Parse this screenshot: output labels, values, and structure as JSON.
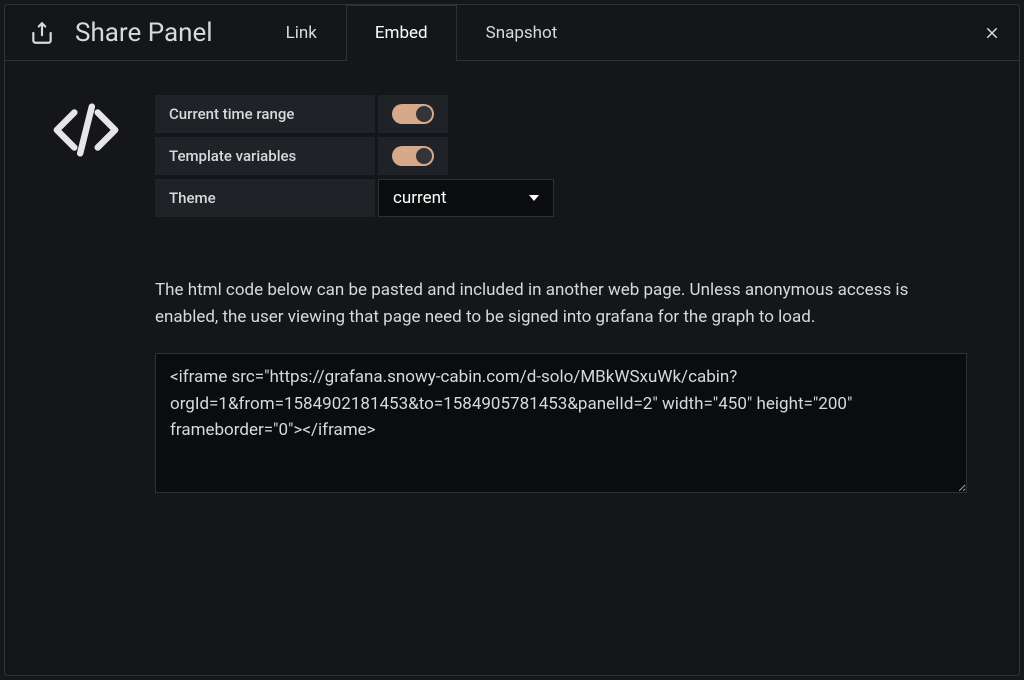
{
  "header": {
    "title": "Share Panel"
  },
  "tabs": {
    "link": "Link",
    "embed": "Embed",
    "snapshot": "Snapshot",
    "active": "embed"
  },
  "options": {
    "current_time_range": {
      "label": "Current time range",
      "value": true
    },
    "template_variables": {
      "label": "Template variables",
      "value": true
    },
    "theme": {
      "label": "Theme",
      "selected": "current"
    }
  },
  "description": "The html code below can be pasted and included in another web page. Unless anonymous access is enabled, the user viewing that page need to be signed into grafana for the graph to load.",
  "embed_code": "<iframe src=\"https://grafana.snowy-cabin.com/d-solo/MBkWSxuWk/cabin?orgId=1&from=1584902181453&to=1584905781453&panelId=2\" width=\"450\" height=\"200\" frameborder=\"0\"></iframe>"
}
